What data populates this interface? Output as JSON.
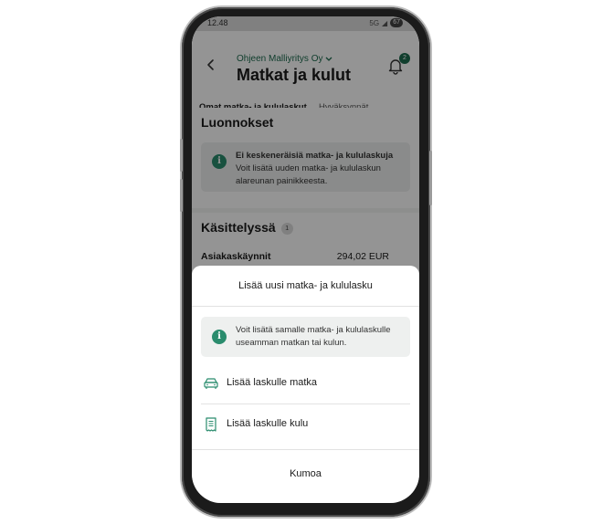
{
  "status_bar": {
    "time": "12.48",
    "battery": "67",
    "signal": "5G"
  },
  "header": {
    "company": "Ohjeen Malliyritys Oy",
    "title": "Matkat ja kulut",
    "notification_count": "2"
  },
  "tabs": [
    {
      "label": "Omat matka- ja kululaskut",
      "active": true
    },
    {
      "label": "Hyväksynnät",
      "active": false
    }
  ],
  "drafts": {
    "title": "Luonnokset",
    "info_title": "Ei keskeneräisiä matka- ja kululaskuja",
    "info_body": "Voit lisätä uuden matka- ja kululaskun alareunan painikkeesta."
  },
  "processing": {
    "title": "Käsittelyssä",
    "count": "1",
    "items": [
      {
        "label": "Asiakaskäynnit",
        "amount": "294,02 EUR"
      }
    ]
  },
  "sheet": {
    "title": "Lisää uusi matka- ja kululasku",
    "info": "Voit lisätä samalle matka- ja kululaskulle useamman matkan tai kulun.",
    "options": [
      {
        "label": "Lisää laskulle matka",
        "icon": "car-icon"
      },
      {
        "label": "Lisää laskulle kulu",
        "icon": "receipt-icon"
      }
    ],
    "cancel": "Kumoa"
  },
  "colors": {
    "accent": "#1d6b4f",
    "info_icon": "#2a8c6d"
  }
}
